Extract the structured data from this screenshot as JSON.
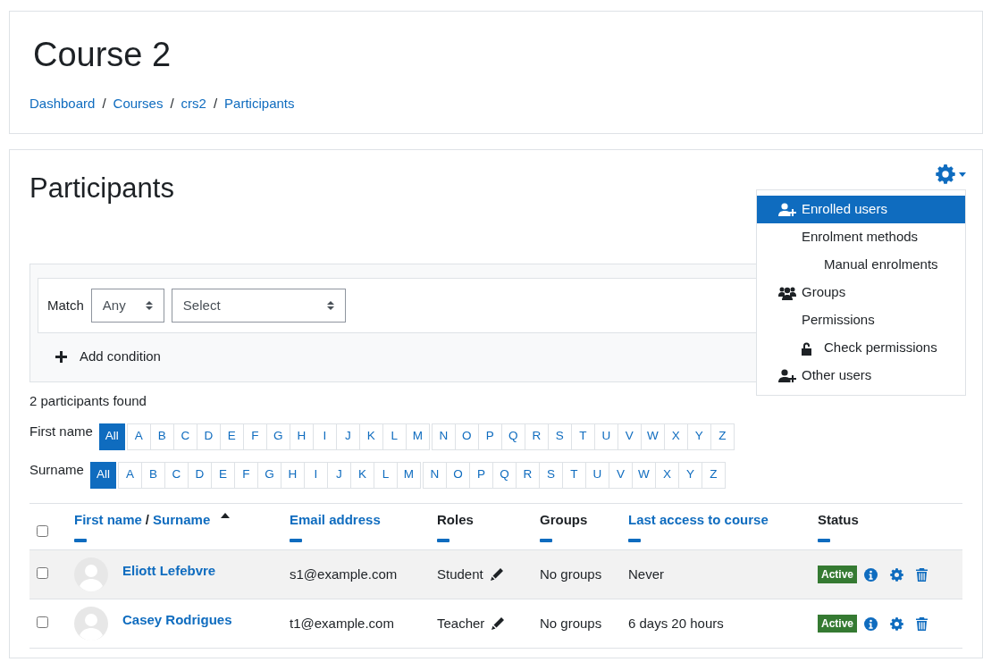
{
  "page_header": {
    "title": "Course 2",
    "separator": "/",
    "breadcrumb": [
      "Dashboard",
      "Courses",
      "crs2",
      "Participants"
    ]
  },
  "participants": {
    "title": "Participants",
    "settings_menu": {
      "expanded": true,
      "items": [
        {
          "label": "Enrolled users",
          "kind": "enrol",
          "selected": true
        },
        {
          "label": "Enrolment methods",
          "kind": "plain",
          "selected": false,
          "children": [
            {
              "label": "Manual enrolments",
              "kind": "plain",
              "selected": false
            }
          ]
        },
        {
          "label": "Groups",
          "kind": "groups",
          "selected": false
        },
        {
          "label": "Permissions",
          "kind": "plain",
          "selected": false,
          "children": [
            {
              "label": "Check permissions",
              "kind": "unlock",
              "selected": false
            }
          ]
        },
        {
          "label": "Other users",
          "kind": "enrol",
          "selected": false
        }
      ]
    },
    "filter": {
      "match_label": "Match",
      "match_value": "Any",
      "condition_value": "Select",
      "add_condition": "Add condition"
    },
    "count": "2 participants found",
    "initials": [
      {
        "label": "First name",
        "groups": [
          [
            {
              "text": "All",
              "selected": true
            }
          ],
          [
            {
              "text": "A",
              "selected": false
            },
            {
              "text": "B",
              "selected": false
            },
            {
              "text": "C",
              "selected": false
            },
            {
              "text": "D",
              "selected": false
            },
            {
              "text": "E",
              "selected": false
            },
            {
              "text": "F",
              "selected": false
            },
            {
              "text": "G",
              "selected": false
            },
            {
              "text": "H",
              "selected": false
            },
            {
              "text": "I",
              "selected": false
            },
            {
              "text": "J",
              "selected": false
            },
            {
              "text": "K",
              "selected": false
            },
            {
              "text": "L",
              "selected": false
            },
            {
              "text": "M",
              "selected": false
            }
          ],
          [
            {
              "text": "N",
              "selected": false
            },
            {
              "text": "O",
              "selected": false
            },
            {
              "text": "P",
              "selected": false
            },
            {
              "text": "Q",
              "selected": false
            },
            {
              "text": "R",
              "selected": false
            },
            {
              "text": "S",
              "selected": false
            },
            {
              "text": "T",
              "selected": false
            },
            {
              "text": "U",
              "selected": false
            },
            {
              "text": "V",
              "selected": false
            },
            {
              "text": "W",
              "selected": false
            },
            {
              "text": "X",
              "selected": false
            },
            {
              "text": "Y",
              "selected": false
            },
            {
              "text": "Z",
              "selected": false
            }
          ]
        ]
      },
      {
        "label": "Surname",
        "groups": [
          [
            {
              "text": "All",
              "selected": true
            }
          ],
          [
            {
              "text": "A",
              "selected": false
            },
            {
              "text": "B",
              "selected": false
            },
            {
              "text": "C",
              "selected": false
            },
            {
              "text": "D",
              "selected": false
            },
            {
              "text": "E",
              "selected": false
            },
            {
              "text": "F",
              "selected": false
            },
            {
              "text": "G",
              "selected": false
            },
            {
              "text": "H",
              "selected": false
            },
            {
              "text": "I",
              "selected": false
            },
            {
              "text": "J",
              "selected": false
            },
            {
              "text": "K",
              "selected": false
            },
            {
              "text": "L",
              "selected": false
            },
            {
              "text": "M",
              "selected": false
            }
          ],
          [
            {
              "text": "N",
              "selected": false
            },
            {
              "text": "O",
              "selected": false
            },
            {
              "text": "P",
              "selected": false
            },
            {
              "text": "Q",
              "selected": false
            },
            {
              "text": "R",
              "selected": false
            },
            {
              "text": "S",
              "selected": false
            },
            {
              "text": "T",
              "selected": false
            },
            {
              "text": "U",
              "selected": false
            },
            {
              "text": "V",
              "selected": false
            },
            {
              "text": "W",
              "selected": false
            },
            {
              "text": "X",
              "selected": false
            },
            {
              "text": "Y",
              "selected": false
            },
            {
              "text": "Z",
              "selected": false
            }
          ]
        ]
      }
    ],
    "table": {
      "select_all_checked": false,
      "columns": [
        {
          "parts": [
            {
              "text": "First name",
              "link": true
            },
            {
              "text": "/",
              "link": false
            },
            {
              "text": "Surname",
              "link": true
            }
          ],
          "sorted_ascending": true
        },
        {
          "parts": [
            {
              "text": "Email address",
              "link": true
            }
          ]
        },
        {
          "parts": [
            {
              "text": "Roles",
              "link": false
            }
          ]
        },
        {
          "parts": [
            {
              "text": "Groups",
              "link": false
            }
          ]
        },
        {
          "parts": [
            {
              "text": "Last access to course",
              "link": true
            }
          ]
        },
        {
          "parts": [
            {
              "text": "Status",
              "link": false
            }
          ]
        }
      ],
      "rows": [
        {
          "checked": false,
          "hovered": true,
          "name": "Eliott Lefebvre",
          "email": "s1@example.com",
          "role": "Student",
          "groups": "No groups",
          "last_access": "Never",
          "status": {
            "text": "Active",
            "kind": "active"
          }
        },
        {
          "checked": false,
          "hovered": false,
          "name": "Casey Rodrigues",
          "email": "t1@example.com",
          "role": "Teacher",
          "groups": "No groups",
          "last_access": "6 days 20 hours",
          "status": {
            "text": "Active",
            "kind": "active"
          }
        }
      ]
    }
  }
}
